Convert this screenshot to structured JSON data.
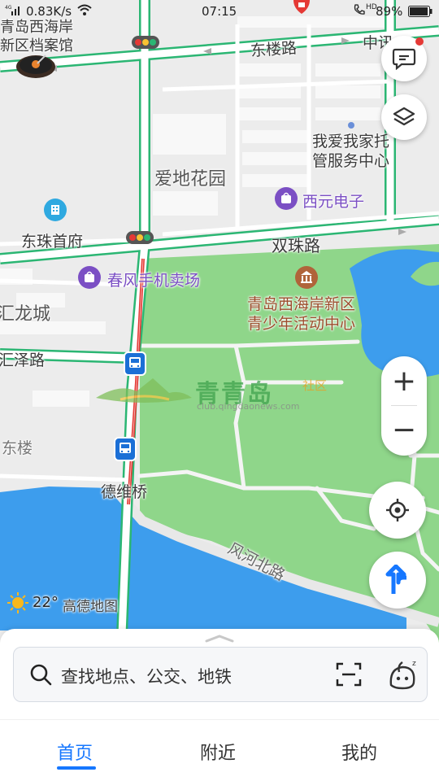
{
  "status_bar": {
    "speed": "0.83K/s",
    "time": "07:15",
    "hd": "HD",
    "battery": "89%"
  },
  "map_labels": {
    "archive_1": "青岛西海岸",
    "archive_2": "新区档案馆",
    "donglou_road": "东楼路",
    "zhongxun": "中讯",
    "childcare_1": "我爱我家托",
    "childcare_2": "管服务中心",
    "aidi_garden": "爱地花园",
    "xiyuan": "西元电子",
    "dongzhu": "东珠首府",
    "shuangzhu_road": "双珠路",
    "chunfeng": "春风手机卖场",
    "huilong": "汇龙城",
    "youth_1": "青岛西海岸新区",
    "youth_2": "青少年活动中心",
    "huize_road": "汇泽路",
    "donglou": "东楼",
    "deweiqiao": "德维桥",
    "fenghe_road": "风河北路"
  },
  "watermark": {
    "brand": "青青岛",
    "tag": "社区",
    "url": "club.qingdaonews.com"
  },
  "weather": {
    "temperature": "22°",
    "provider": "高德地图"
  },
  "controls": {
    "zoom_in": "+",
    "zoom_out": "−"
  },
  "search": {
    "placeholder": "查找地点、公交、地铁"
  },
  "tabs": [
    {
      "label": "首页",
      "active": true
    },
    {
      "label": "附近",
      "active": false
    },
    {
      "label": "我的",
      "active": false
    }
  ],
  "colors": {
    "road_outline": "#2bb673",
    "park": "#8fd68a",
    "water": "#3d9ded",
    "accent": "#1677ff",
    "poi_purple": "#7b4fc4",
    "poi_brown": "#b0643a"
  }
}
